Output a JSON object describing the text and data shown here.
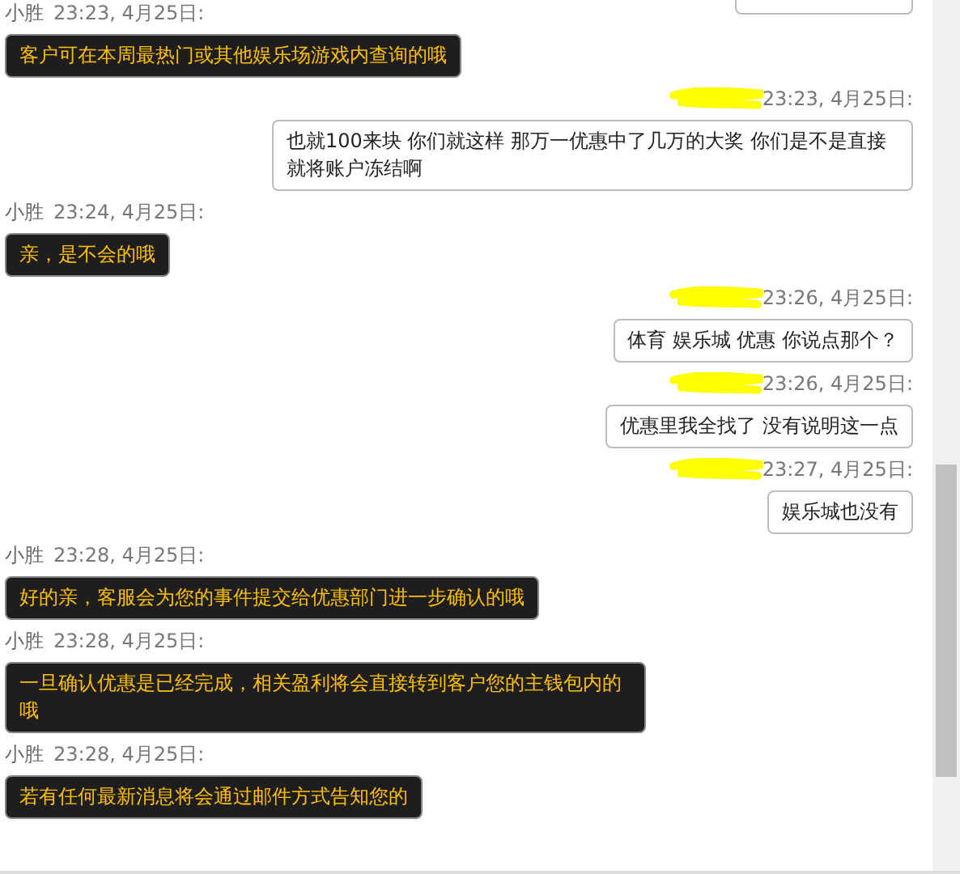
{
  "messages": [
    {
      "kind": "agent",
      "sender": "小胜",
      "time": "23:23, 4月25日:",
      "text": "客户可在本周最热门或其他娱乐场游戏内查询的哦"
    },
    {
      "kind": "customer",
      "redacted": true,
      "time": "23:23, 4月25日:",
      "text": "也就100来块 你们就这样 那万一优惠中了几万的大奖 你们是不是直接就将账户冻结啊"
    },
    {
      "kind": "agent",
      "sender": "小胜",
      "time": "23:24, 4月25日:",
      "text": "亲，是不会的哦"
    },
    {
      "kind": "customer",
      "redacted": true,
      "time": "23:26, 4月25日:",
      "text": "体育 娱乐城 优惠 你说点那个？"
    },
    {
      "kind": "customer",
      "redacted": true,
      "time": "23:26, 4月25日:",
      "text": "优惠里我全找了 没有说明这一点"
    },
    {
      "kind": "customer",
      "redacted": true,
      "time": "23:27, 4月25日:",
      "text": "娱乐城也没有"
    },
    {
      "kind": "agent",
      "sender": "小胜",
      "time": "23:28, 4月25日:",
      "text": "好的亲，客服会为您的事件提交给优惠部门进一步确认的哦"
    },
    {
      "kind": "agent",
      "sender": "小胜",
      "time": "23:28, 4月25日:",
      "text": "一旦确认优惠是已经完成，相关盈利将会直接转到客户您的主钱包内的哦"
    },
    {
      "kind": "agent",
      "sender": "小胜",
      "time": "23:28, 4月25日:",
      "text": "若有任何最新消息将会通过邮件方式告知您的"
    }
  ]
}
